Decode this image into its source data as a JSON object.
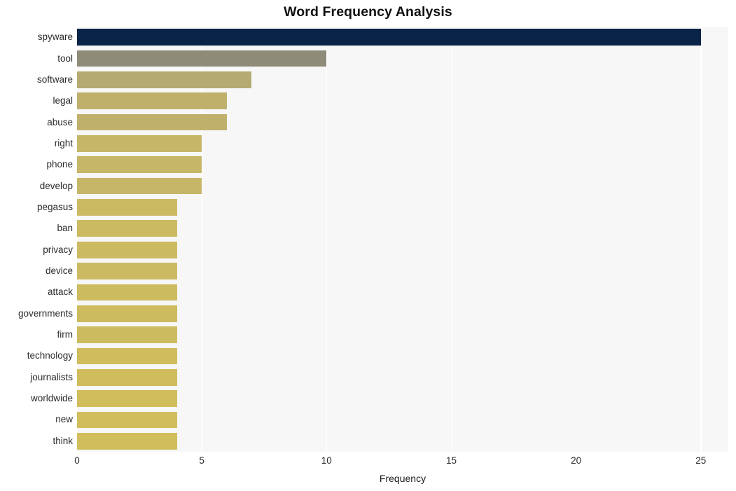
{
  "chart_data": {
    "type": "bar",
    "orientation": "horizontal",
    "title": "Word Frequency Analysis",
    "xlabel": "Frequency",
    "ylabel": "",
    "categories": [
      "spyware",
      "tool",
      "software",
      "legal",
      "abuse",
      "right",
      "phone",
      "develop",
      "pegasus",
      "ban",
      "privacy",
      "device",
      "attack",
      "governments",
      "firm",
      "technology",
      "journalists",
      "worldwide",
      "new",
      "think"
    ],
    "values": [
      25,
      10,
      7,
      6,
      6,
      5,
      5,
      5,
      4,
      4,
      4,
      4,
      4,
      4,
      4,
      4,
      4,
      4,
      4,
      4
    ],
    "bar_colors": [
      "#0a2447",
      "#8f8b79",
      "#b5ab72",
      "#bfb16b",
      "#bfb16b",
      "#c6b667",
      "#c6b667",
      "#c6b667",
      "#cbba62",
      "#cbba62",
      "#cbba62",
      "#cbba62",
      "#cdbc5f",
      "#cdbc5f",
      "#cdbc5f",
      "#cfbd5d",
      "#cfbd5d",
      "#d0be5c",
      "#d0be5c",
      "#d0be5c"
    ],
    "xticks": [
      0,
      5,
      10,
      15,
      20,
      25
    ],
    "xtick_labels": [
      "0",
      "5",
      "10",
      "15",
      "20",
      "25"
    ],
    "xlim": [
      0,
      26.1
    ],
    "grid": true,
    "grid_axis": "x",
    "grid_color": "#ffffff",
    "plot_background": "#f7f7f7",
    "figure_background": "#ffffff",
    "legend": null
  }
}
